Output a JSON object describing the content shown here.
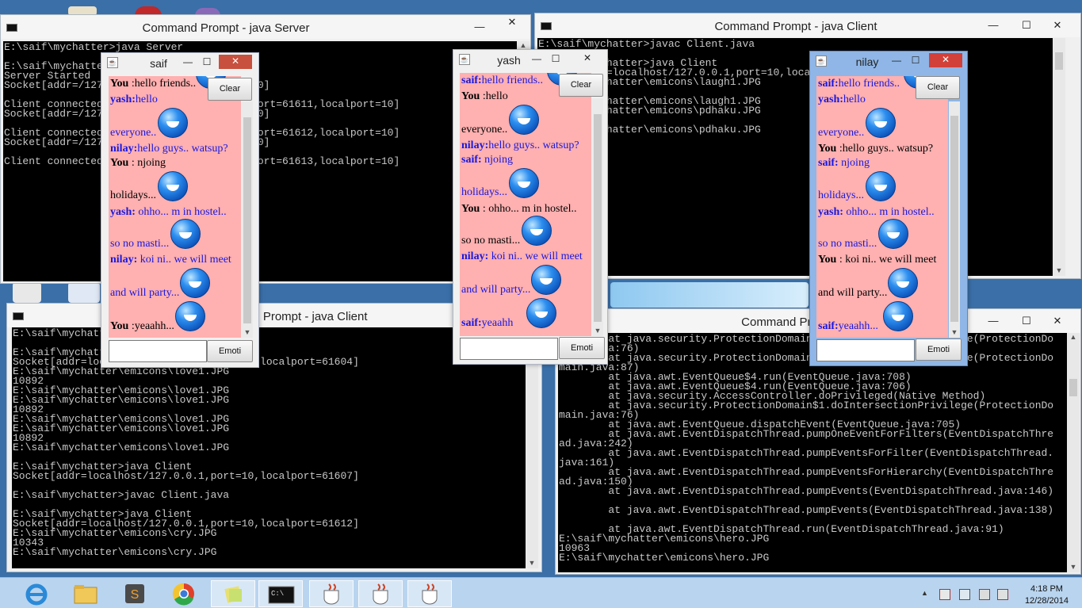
{
  "desktop": {
    "background": "#3a6fa8"
  },
  "windows": {
    "cmd_server": {
      "title": "Command Prompt - java  Server",
      "lines": [
        "E:\\saif\\mychatter>java Server",
        "",
        "E:\\saif\\mychatter>java Server",
        "Server Started",
        "Socket[addr=/127.0.0.1,port=1,localport=10]",
        "",
        "Client connected:Socket[addr=/127.0.0.1,port=61611,localport=10]",
        "Socket[addr=/127.0.0.1,port=1,localport=10]",
        "",
        "Client connected:Socket[addr=/127.0.0.1,port=61612,localport=10]",
        "Socket[addr=/127.0.0.1,port=1,localport=10]",
        "",
        "Client connected:Socket[addr=/127.0.0.1,port=61613,localport=10]"
      ]
    },
    "cmd_client_top": {
      "title": "Command Prompt - java  Client",
      "lines": [
        "E:\\saif\\mychatter>javac Client.java",
        "",
        "E:\\saif\\mychatter>java Client",
        "Socket[addr=localhost/127.0.0.1,port=10,localport=61613]",
        "E:\\saif\\mychatter\\emicons\\laugh1.JPG",
        "",
        "E:\\saif\\mychatter\\emicons\\laugh1.JPG",
        "E:\\saif\\mychatter\\emicons\\pdhaku.JPG",
        "",
        "E:\\saif\\mychatter\\emicons\\pdhaku.JPG"
      ]
    },
    "cmd_client_bottom": {
      "title": "Command Prompt - java  Client",
      "lines": [
        "E:\\saif\\mychatter>java Client",
        "",
        "E:\\saif\\mychatter>java Client",
        "Socket[addr=localhost/127.0.0.1,port=10,localport=61604]",
        "E:\\saif\\mychatter\\emicons\\love1.JPG",
        "10892",
        "E:\\saif\\mychatter\\emicons\\love1.JPG",
        "E:\\saif\\mychatter\\emicons\\love1.JPG",
        "10892",
        "E:\\saif\\mychatter\\emicons\\love1.JPG",
        "E:\\saif\\mychatter\\emicons\\love1.JPG",
        "10892",
        "E:\\saif\\mychatter\\emicons\\love1.JPG",
        "",
        "E:\\saif\\mychatter>java Client",
        "Socket[addr=localhost/127.0.0.1,port=10,localport=61607]",
        "",
        "E:\\saif\\mychatter>javac Client.java",
        "",
        "E:\\saif\\mychatter>java Client",
        "Socket[addr=localhost/127.0.0.1,port=10,localport=61612]",
        "E:\\saif\\mychatter\\emicons\\cry.JPG",
        "10343",
        "E:\\saif\\mychatter\\emicons\\cry.JPG"
      ]
    },
    "cmd_error": {
      "title": "Command Prompt",
      "lines": [
        "        at java.security.ProtectionDomain$1.doIntersectionPrivilege(ProtectionDo",
        "main.java:76)",
        "        at java.security.ProtectionDomain$1.doIntersectionPrivilege(ProtectionDo",
        "main.java:87)",
        "        at java.awt.EventQueue$4.run(EventQueue.java:708)",
        "        at java.awt.EventQueue$4.run(EventQueue.java:706)",
        "        at java.security.AccessController.doPrivileged(Native Method)",
        "        at java.security.ProtectionDomain$1.doIntersectionPrivilege(ProtectionDo",
        "main.java:76)",
        "        at java.awt.EventQueue.dispatchEvent(EventQueue.java:705)",
        "        at java.awt.EventDispatchThread.pumpOneEventForFilters(EventDispatchThre",
        "ad.java:242)",
        "        at java.awt.EventDispatchThread.pumpEventsForFilter(EventDispatchThread.",
        "java:161)",
        "        at java.awt.EventDispatchThread.pumpEventsForHierarchy(EventDispatchThre",
        "ad.java:150)",
        "        at java.awt.EventDispatchThread.pumpEvents(EventDispatchThread.java:146)",
        "",
        "        at java.awt.EventDispatchThread.pumpEvents(EventDispatchThread.java:138)",
        "",
        "        at java.awt.EventDispatchThread.run(EventDispatchThread.java:91)",
        "E:\\saif\\mychatter\\emicons\\hero.JPG",
        "10963",
        "E:\\saif\\mychatter\\emicons\\hero.JPG"
      ]
    }
  },
  "chat_common": {
    "clear_label": "Clear",
    "emoti_label": "Emoti"
  },
  "chats": {
    "saif": {
      "title": "saif",
      "messages": [
        {
          "name": "You",
          "text": " :hello friends..",
          "self": true
        },
        {
          "name": "yash:",
          "text": "hello",
          "self": false
        },
        {
          "name": "",
          "text": "everyone..",
          "self": false
        },
        {
          "name": "nilay:",
          "text": "hello guys.. watsup?",
          "self": false
        },
        {
          "name": "You",
          "text": " : njoing",
          "self": true
        },
        {
          "name": "",
          "text": "holidays...",
          "self": true
        },
        {
          "name": "yash:",
          "text": " ohho... m in hostel..",
          "self": false
        },
        {
          "name": "",
          "text": "so no masti...",
          "self": false
        },
        {
          "name": "nilay:",
          "text": " koi ni.. we will meet",
          "self": false
        },
        {
          "name": "",
          "text": "and will party...",
          "self": false
        },
        {
          "name": "You",
          "text": " :yeaahh...",
          "self": true
        }
      ]
    },
    "yash": {
      "title": "yash",
      "messages": [
        {
          "name": "saif:",
          "text": "hello friends..",
          "self": false
        },
        {
          "name": "You",
          "text": " :hello",
          "self": true
        },
        {
          "name": "",
          "text": "everyone..",
          "self": true
        },
        {
          "name": "nilay:",
          "text": "hello guys.. watsup?",
          "self": false
        },
        {
          "name": "saif:",
          "text": " njoing",
          "self": false
        },
        {
          "name": "",
          "text": "holidays...",
          "self": false
        },
        {
          "name": "You",
          "text": " : ohho... m in hostel..",
          "self": true
        },
        {
          "name": "",
          "text": "so no masti...",
          "self": true
        },
        {
          "name": "nilay:",
          "text": " koi ni.. we will meet",
          "self": false
        },
        {
          "name": "",
          "text": "and will party...",
          "self": false
        },
        {
          "name": "saif:",
          "text": "yeaahh",
          "self": false
        }
      ]
    },
    "nilay": {
      "title": "nilay",
      "messages": [
        {
          "name": "saif:",
          "text": "hello friends..",
          "self": false
        },
        {
          "name": "yash:",
          "text": "hello",
          "self": false
        },
        {
          "name": "",
          "text": "everyone..",
          "self": false
        },
        {
          "name": "You",
          "text": " :hello guys.. watsup?",
          "self": true
        },
        {
          "name": "saif:",
          "text": " njoing",
          "self": false
        },
        {
          "name": "",
          "text": "holidays...",
          "self": false
        },
        {
          "name": "yash:",
          "text": " ohho... m in hostel..",
          "self": false
        },
        {
          "name": "",
          "text": "so no masti...",
          "self": false
        },
        {
          "name": "You",
          "text": " : koi ni.. we will meet",
          "self": true
        },
        {
          "name": "",
          "text": "and will party...",
          "self": true
        },
        {
          "name": "saif:",
          "text": "yeaahh...",
          "self": false
        }
      ]
    }
  },
  "taskbar": {
    "time": "4:18 PM",
    "date": "12/28/2014",
    "color": "#b9d4ef"
  }
}
